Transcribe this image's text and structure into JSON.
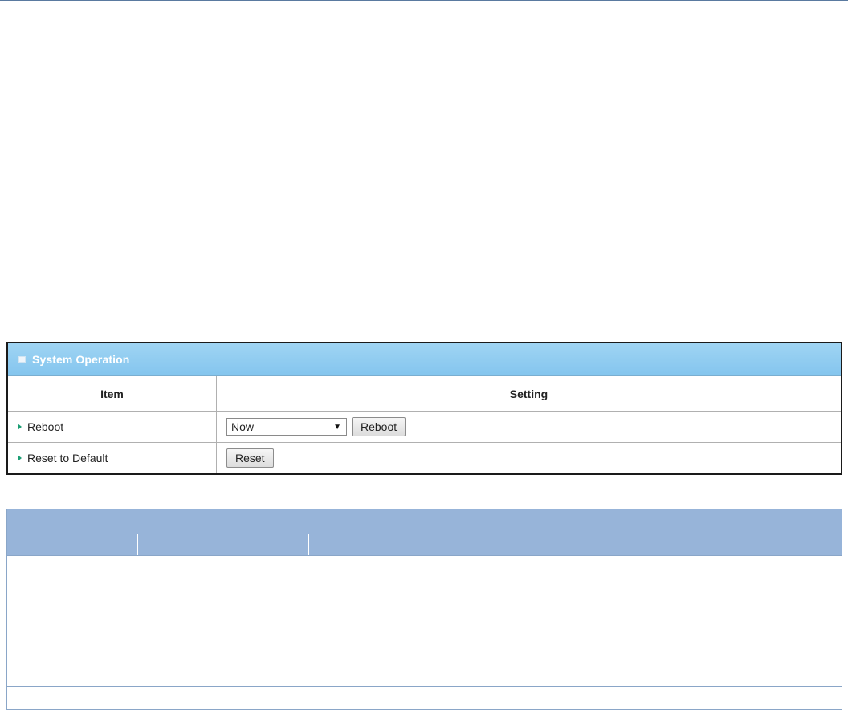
{
  "panel": {
    "title": "System Operation",
    "header_color": "#8fcbf0",
    "columns": {
      "item": "Item",
      "setting": "Setting"
    },
    "rows": [
      {
        "label": "Reboot",
        "select_value": "Now",
        "button_label": "Reboot"
      },
      {
        "label": "Reset to Default",
        "button_label": "Reset"
      }
    ]
  },
  "table2": {
    "header_color": "#97b4d9"
  },
  "icons": {
    "panel_icon": "panel-square-icon",
    "row_bullet": "triangle-right-icon",
    "select_arrow": "chevron-down-icon"
  }
}
